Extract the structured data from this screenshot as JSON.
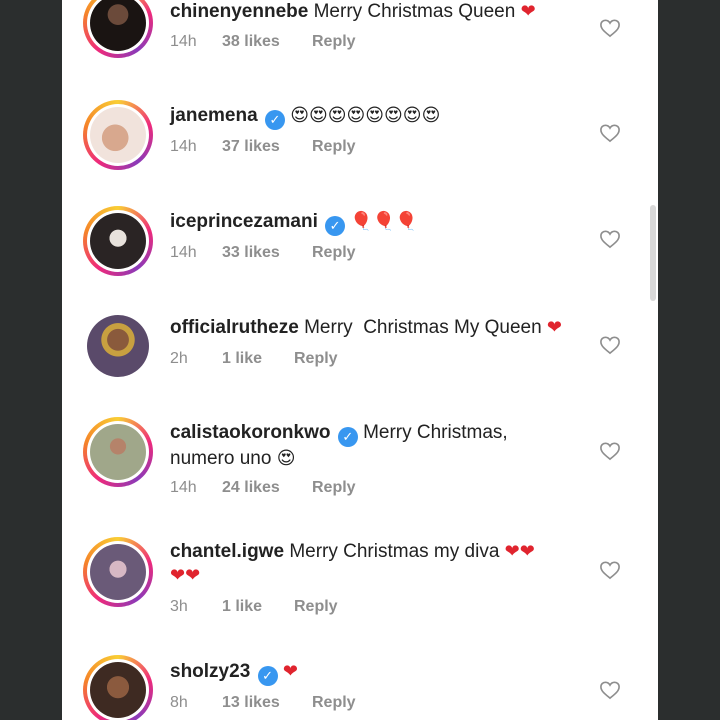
{
  "comments": [
    {
      "username": "chinenyennebe",
      "verified": false,
      "text": "Merry Christmas Queen",
      "emoji": "❤",
      "time": "14h",
      "likes": "38 likes",
      "reply": "Reply"
    },
    {
      "username": "janemena",
      "verified": true,
      "text": "",
      "emoji": "😍😍😍😍😍😍😍😍",
      "time": "14h",
      "likes": "37 likes",
      "reply": "Reply"
    },
    {
      "username": "iceprincezamani",
      "verified": true,
      "text": "",
      "emoji": "🎈🎈🎈",
      "time": "14h",
      "likes": "33 likes",
      "reply": "Reply"
    },
    {
      "username": "officialrutheze",
      "verified": false,
      "text": "Merry  Christmas My Queen",
      "emoji": "❤",
      "time": "2h",
      "likes": "1 like",
      "reply": "Reply"
    },
    {
      "username": "calistaokoronkwo",
      "verified": true,
      "text": "Merry Christmas,",
      "text2": "numero uno",
      "emoji": "😍",
      "time": "14h",
      "likes": "24 likes",
      "reply": "Reply"
    },
    {
      "username": "chantel.igwe",
      "verified": false,
      "text": "Merry Christmas my diva",
      "emoji": "❤❤",
      "emoji2": "❤❤",
      "time": "3h",
      "likes": "1 like",
      "reply": "Reply"
    },
    {
      "username": "sholzy23",
      "verified": true,
      "text": "",
      "emoji": "❤",
      "time": "8h",
      "likes": "13 likes",
      "reply": "Reply"
    }
  ],
  "icons": {
    "heart": "heart-outline-icon",
    "verified": "verified-badge-icon"
  },
  "colors": {
    "background": "#2b2e2e",
    "panel": "#ffffff",
    "muted": "#8e8e8e",
    "verified": "#3897f0",
    "heart_emoji": "#e0242e"
  }
}
